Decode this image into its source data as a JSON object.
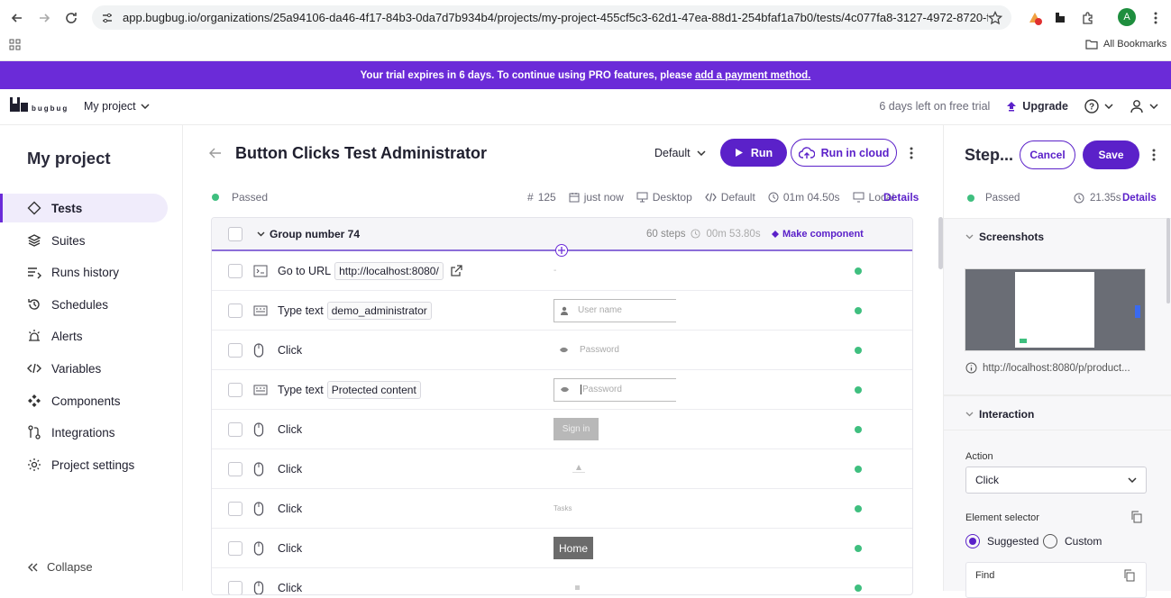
{
  "browser": {
    "url": "app.bugbug.io/organizations/25a94106-da46-4f17-84b3-0da7d7b934b4/projects/my-project-455cf5c3-62d1-47ea-88d1-254bfaf1a7b0/tests/4c077fa8-3127-4972-8720-f3dc9251d...",
    "all_bookmarks": "All Bookmarks",
    "profile_initial": "A"
  },
  "banner": {
    "text": "Your trial expires in 6 days. To continue using PRO features, please",
    "link": "add a payment method."
  },
  "topbar": {
    "logo_text": "bugbug",
    "project": "My project",
    "trial_left": "6 days left on free trial",
    "upgrade": "Upgrade"
  },
  "sidebar": {
    "title": "My project",
    "items": [
      {
        "label": "Tests",
        "icon": "diamond-icon"
      },
      {
        "label": "Suites",
        "icon": "layers-icon"
      },
      {
        "label": "Runs history",
        "icon": "history-list-icon"
      },
      {
        "label": "Schedules",
        "icon": "clock-history-icon"
      },
      {
        "label": "Alerts",
        "icon": "alarm-icon"
      },
      {
        "label": "Variables",
        "icon": "code-icon"
      },
      {
        "label": "Components",
        "icon": "components-icon"
      },
      {
        "label": "Integrations",
        "icon": "integrations-icon"
      },
      {
        "label": "Project settings",
        "icon": "gear-icon"
      }
    ],
    "collapse": "Collapse"
  },
  "test": {
    "title": "Button Clicks Test Administrator",
    "profile": "Default",
    "run": "Run",
    "run_cloud": "Run in cloud",
    "status": "Passed",
    "run_number": "125",
    "when": "just now",
    "device": "Desktop",
    "variables_profile": "Default",
    "duration": "01m 04.50s",
    "environment": "Local",
    "details": "Details"
  },
  "group": {
    "name": "Group number 74",
    "steps": "60 steps",
    "duration": "00m 53.80s",
    "make_component": "Make component"
  },
  "steps": [
    {
      "type": "Go to URL",
      "value": "http://localhost:8080/",
      "icon": "terminal-icon",
      "preview": "-"
    },
    {
      "type": "Type text",
      "value": "demo_administrator",
      "icon": "keyboard-icon",
      "preview": "User name"
    },
    {
      "type": "Click",
      "value": "",
      "icon": "mouse-icon",
      "preview": "Password"
    },
    {
      "type": "Type text",
      "value": "Protected content",
      "icon": "keyboard-icon",
      "preview": "Password"
    },
    {
      "type": "Click",
      "value": "",
      "icon": "mouse-icon",
      "preview": "Sign in"
    },
    {
      "type": "Click",
      "value": "",
      "icon": "mouse-icon",
      "preview": ""
    },
    {
      "type": "Click",
      "value": "",
      "icon": "mouse-icon",
      "preview": "Tasks"
    },
    {
      "type": "Click",
      "value": "",
      "icon": "mouse-icon",
      "preview": "Home"
    },
    {
      "type": "Click",
      "value": "",
      "icon": "mouse-icon",
      "preview": ""
    }
  ],
  "details_panel": {
    "title": "Step...",
    "cancel": "Cancel",
    "save": "Save",
    "status": "Passed",
    "duration": "21.35s",
    "details": "Details",
    "screenshots": "Screenshots",
    "screenshot_url": "http://localhost:8080/p/product...",
    "interaction": "Interaction",
    "action_label": "Action",
    "action_value": "Click",
    "selector_label": "Element selector",
    "suggested": "Suggested",
    "custom": "Custom",
    "find": "Find"
  },
  "colors": {
    "brand": "#6b2bd8",
    "button": "#5b21c9",
    "success": "#3fbf7f"
  }
}
